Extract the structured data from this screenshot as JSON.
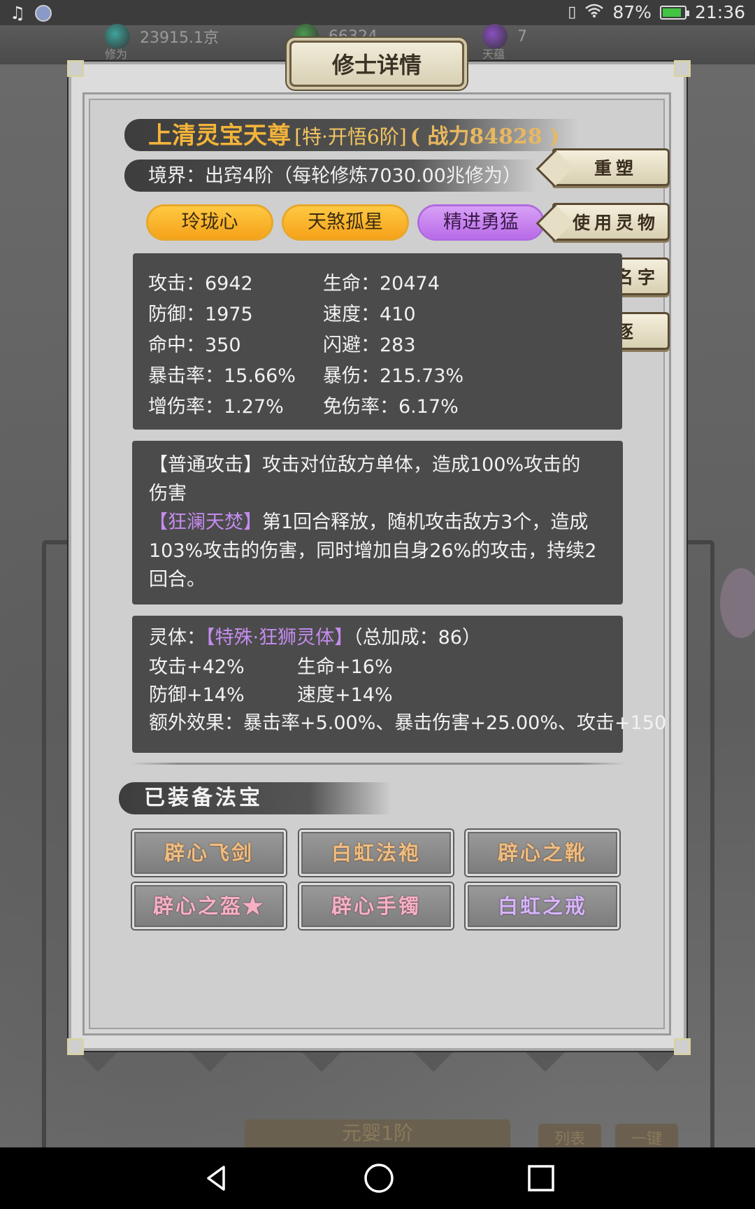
{
  "status_bar": {
    "battery_text": "87%",
    "battery_level": 0.87,
    "time": "21:36",
    "icons": [
      "music-icon",
      "app-badge-icon",
      "vibrate-icon",
      "wifi-icon",
      "battery-icon"
    ]
  },
  "background": {
    "resources": [
      {
        "value": "23915.1京",
        "label": "修为",
        "color": "#3fa39a"
      },
      {
        "value": "66324",
        "label": "",
        "color": "#4c9a50"
      },
      {
        "value": "7",
        "label": "天蕴",
        "color": "#8a4fc0"
      }
    ],
    "bottom_label": "元婴1阶",
    "bottom_btn_1": "列表",
    "bottom_btn_2": "一键"
  },
  "dialog": {
    "title": "修士详情",
    "name": "上清灵宝天尊",
    "rank": "[特·开悟6阶]",
    "power_label": "战力",
    "power_value": "84828",
    "realm": "境界：出窍4阶（每轮修炼7030.00兆修为）",
    "traits": [
      {
        "label": "玲珑心",
        "color": "orange"
      },
      {
        "label": "天煞孤星",
        "color": "orange"
      },
      {
        "label": "精进勇猛",
        "color": "purple"
      }
    ],
    "side_buttons": [
      "重塑",
      "使用灵物",
      "修改名字",
      "驱逐"
    ],
    "stats": {
      "attack": "攻击：6942",
      "hp": "生命：20474",
      "defense": "防御：1975",
      "speed": "速度：410",
      "hit": "命中：350",
      "dodge": "闪避：283",
      "crit_rate": "暴击率：15.66%",
      "crit_dmg": "暴伤：215.73%",
      "dmg_inc": "增伤率：1.27%",
      "dmg_red": "免伤率：6.17%"
    },
    "skills": {
      "normal_name": "【普通攻击】",
      "normal_desc_1": "攻击对位敌方单体，造成100%攻击的",
      "normal_desc_2": "伤害",
      "special_name": "【狂澜天焚】",
      "special_desc_1": "第1回合释放，随机攻击敌方3个，造成",
      "special_desc_2": "103%攻击的伤害，同时增加自身26%的攻击，持续2",
      "special_desc_3": "回合。"
    },
    "spirit_body": {
      "label": "灵体：",
      "name": "【特殊·狂狮灵体】",
      "total": "（总加成：86）",
      "attack": "攻击+42%",
      "hp": "生命+16%",
      "defense": "防御+14%",
      "speed": "速度+14%",
      "extra": "额外效果：暴击率+5.00%、暴击伤害+25.00%、攻击+150"
    },
    "equipped_title": "已装备法宝",
    "treasures": [
      {
        "name": "辟心飞剑",
        "color": "orange"
      },
      {
        "name": "白虹法袍",
        "color": "orange"
      },
      {
        "name": "辟心之靴",
        "color": "orange"
      },
      {
        "name": "辟心之盔★",
        "color": "pink"
      },
      {
        "name": "辟心手镯",
        "color": "pink"
      },
      {
        "name": "白虹之戒",
        "color": "violet"
      }
    ]
  },
  "nav_bar": {
    "icons": [
      "back-icon",
      "home-icon",
      "recents-icon"
    ]
  }
}
